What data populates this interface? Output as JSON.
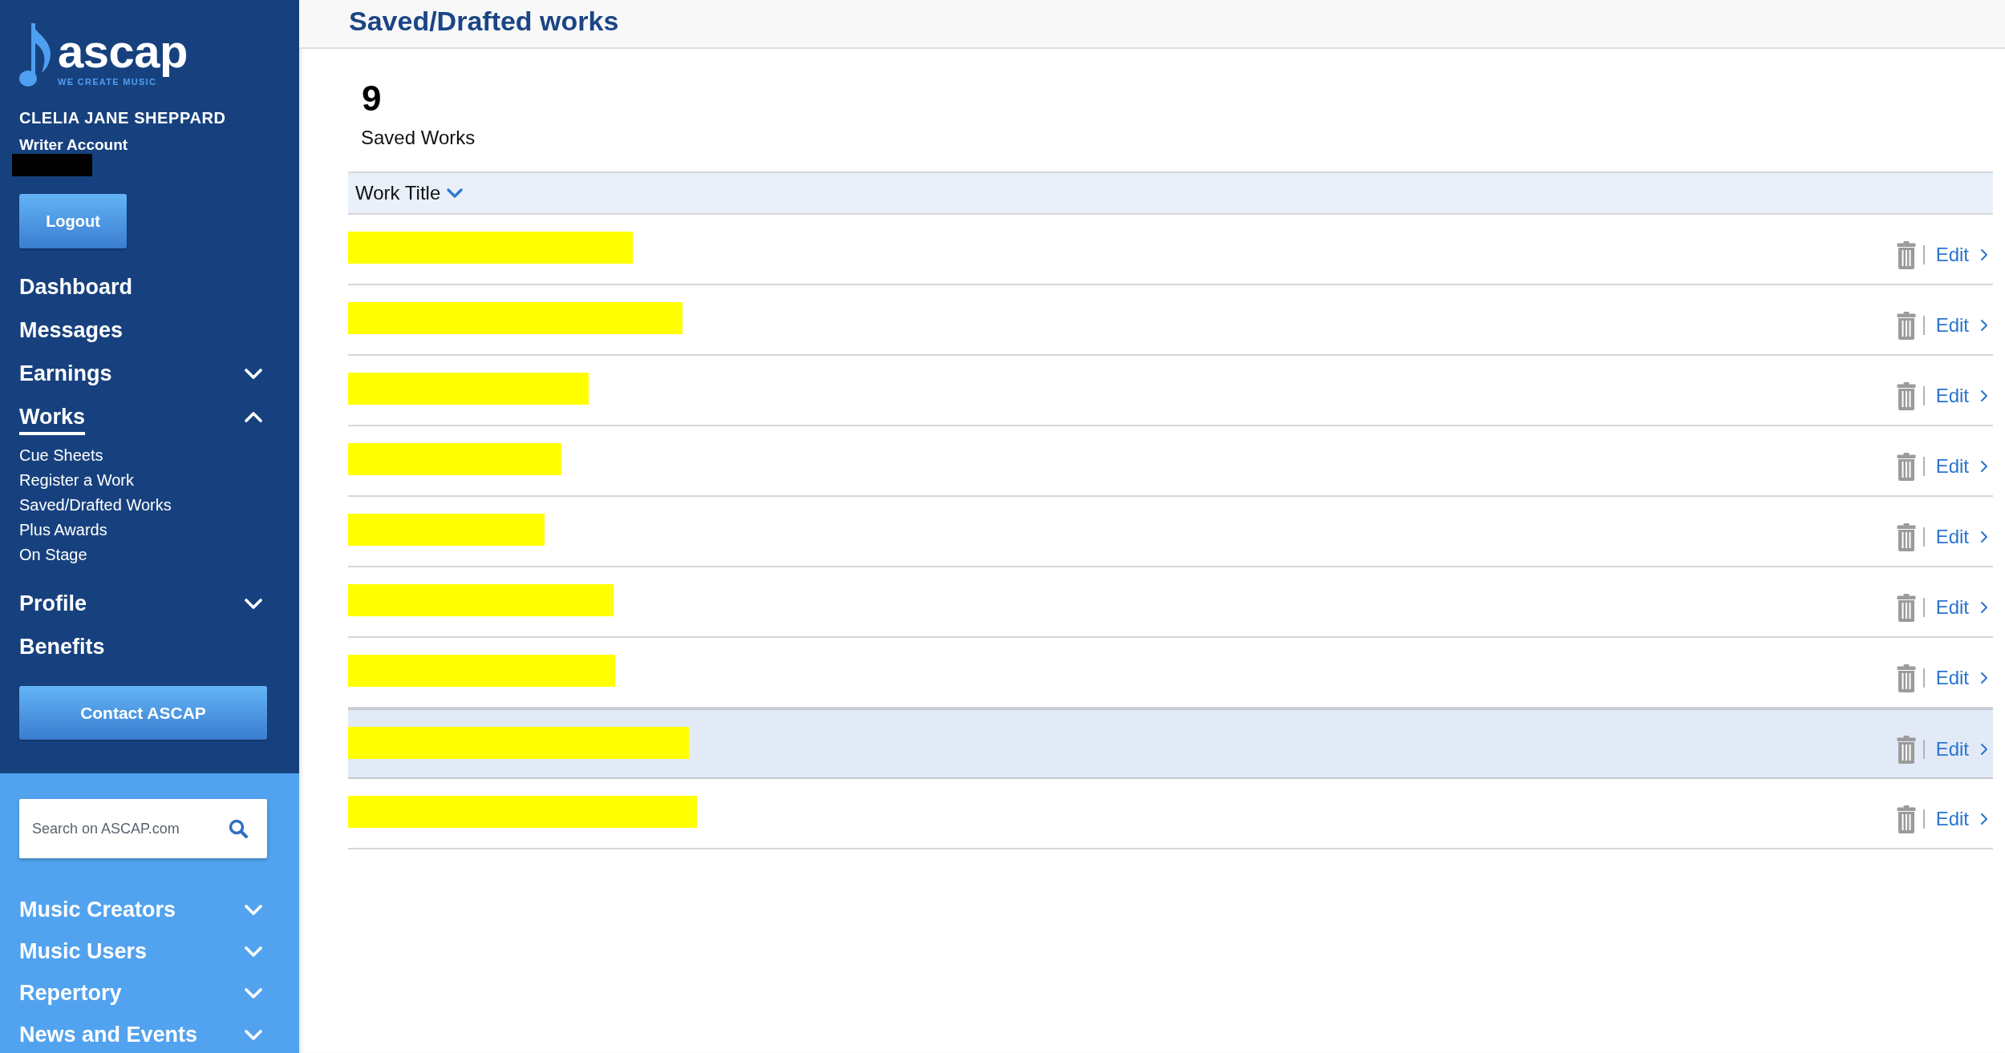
{
  "sidebar": {
    "logo": {
      "wordmark": "ascap",
      "tagline": "WE CREATE MUSIC"
    },
    "user": {
      "name": "CLELIA JANE SHEPPARD",
      "account_type": "Writer Account",
      "id_redacted": true
    },
    "logout_button": "Logout",
    "nav": [
      {
        "label": "Dashboard",
        "kind": "link",
        "selected": false
      },
      {
        "label": "Messages",
        "kind": "link",
        "selected": false
      },
      {
        "label": "Earnings",
        "kind": "group",
        "selected": false,
        "expanded": false
      },
      {
        "label": "Works",
        "kind": "group",
        "selected": true,
        "expanded": true,
        "children": [
          {
            "label": "Cue Sheets",
            "selected": false
          },
          {
            "label": "Register a Work",
            "selected": false
          },
          {
            "label": "Saved/Drafted Works",
            "selected": false
          },
          {
            "label": "Plus Awards",
            "selected": false
          },
          {
            "label": "On Stage",
            "selected": false
          }
        ]
      },
      {
        "label": "Profile",
        "kind": "group",
        "selected": false,
        "expanded": false
      },
      {
        "label": "Benefits",
        "kind": "link",
        "selected": false
      }
    ],
    "contact_button": "Contact ASCAP",
    "search": {
      "placeholder": "Search on ASCAP.com"
    },
    "site_nav": [
      {
        "label": "Music Creators",
        "expanded": false
      },
      {
        "label": "Music Users",
        "expanded": false
      },
      {
        "label": "Repertory",
        "expanded": false
      },
      {
        "label": "News and Events",
        "expanded": false
      }
    ]
  },
  "main": {
    "title": "Saved/Drafted works",
    "count": "9",
    "count_label": "Saved Works",
    "table": {
      "columns": [
        {
          "label": "Work Title",
          "sort_descending": true
        }
      ],
      "rows": [
        {
          "title_redacted": true,
          "highlighted": false,
          "action": "Edit"
        },
        {
          "title_redacted": true,
          "highlighted": false,
          "action": "Edit"
        },
        {
          "title_redacted": true,
          "highlighted": false,
          "action": "Edit"
        },
        {
          "title_redacted": true,
          "highlighted": false,
          "action": "Edit"
        },
        {
          "title_redacted": true,
          "highlighted": false,
          "action": "Edit"
        },
        {
          "title_redacted": true,
          "highlighted": false,
          "action": "Edit"
        },
        {
          "title_redacted": true,
          "highlighted": false,
          "action": "Edit"
        },
        {
          "title_redacted": true,
          "highlighted": true,
          "action": "Edit"
        },
        {
          "title_redacted": true,
          "highlighted": false,
          "action": "Edit"
        }
      ]
    }
  }
}
